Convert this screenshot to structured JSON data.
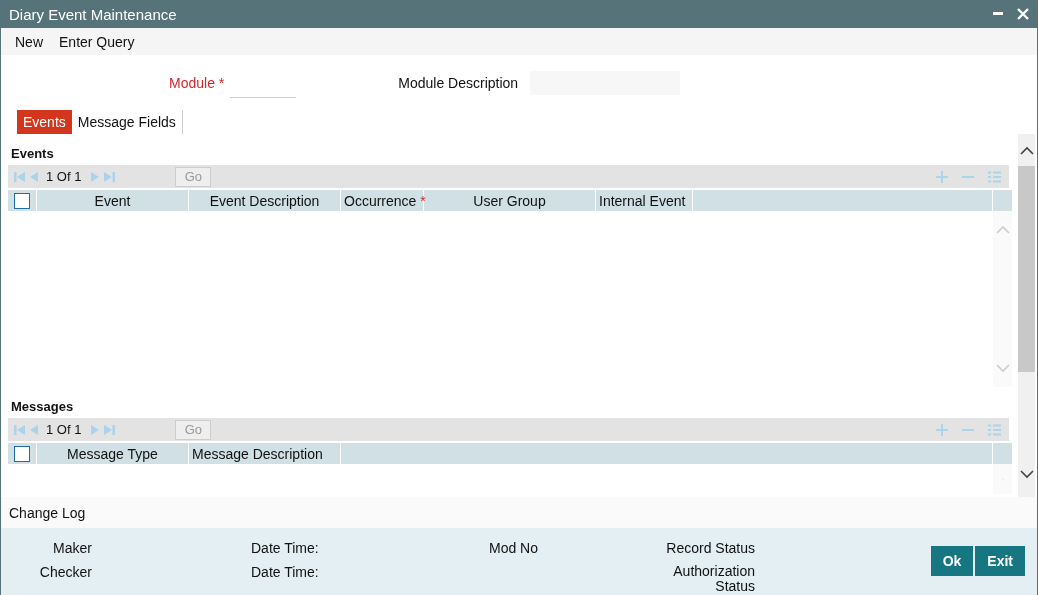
{
  "window": {
    "title": "Diary Event Maintenance"
  },
  "menu": [
    "New",
    "Enter Query"
  ],
  "form": {
    "module": {
      "label": "Module",
      "required_mark": "*"
    },
    "module_description": {
      "label": "Module Description"
    }
  },
  "tabs": [
    {
      "label": "Events",
      "selected": true
    },
    {
      "label": "Message Fields",
      "selected": false
    }
  ],
  "grids": [
    {
      "title": "Events",
      "pager": "1 Of 1",
      "go": "Go",
      "select_all": {
        "checked": false
      },
      "columns": [
        {
          "label": "Event"
        },
        {
          "label": "Event Description"
        },
        {
          "label": "Occurrence",
          "required_mark": "*"
        },
        {
          "label": "User Group"
        },
        {
          "label": "Internal Event"
        }
      ]
    },
    {
      "title": "Messages",
      "pager": "1 Of 1",
      "go": "Go",
      "select_all": {
        "checked": false
      },
      "columns": [
        {
          "label": "Message Type"
        },
        {
          "label": "Message Description"
        }
      ]
    }
  ],
  "change_log": {
    "title": "Change Log",
    "fields": [
      {
        "label": "Maker",
        "kind": "user"
      },
      {
        "label": "Date Time:",
        "kind": "time"
      },
      {
        "label": "Mod No",
        "kind": "mod"
      },
      {
        "label": "Record Status",
        "kind": "status"
      },
      {
        "label": "Checker",
        "kind": "user"
      },
      {
        "label": "Date Time:",
        "kind": "time"
      },
      {
        "label": "Authorization Status",
        "kind": "status"
      }
    ]
  },
  "buttons": [
    "Ok",
    "Exit"
  ]
}
